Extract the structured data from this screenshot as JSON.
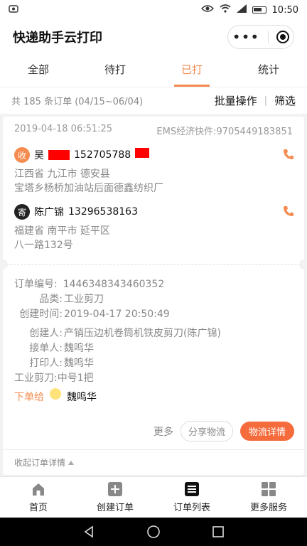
{
  "status_bar": {
    "time": "10:50"
  },
  "app": {
    "title": "快递助手云打印"
  },
  "tabs": [
    {
      "label": "全部",
      "active": false
    },
    {
      "label": "待打",
      "active": false
    },
    {
      "label": "已打",
      "active": true
    },
    {
      "label": "统计",
      "active": false
    }
  ],
  "summary": {
    "count_text": "共 185 条订单 (04/15~06/04)",
    "batch_label": "批量操作",
    "filter_label": "筛选"
  },
  "order": {
    "datetime": "2019-04-18 06:51:25",
    "carrier_tracking": "EMS经济快件:9705449183851",
    "recipient": {
      "badge": "收",
      "name_prefix": "吴",
      "phone_partial": "152705788",
      "address_line1": "江西省 九江市 德安县",
      "address_line2": "宝塔乡杨桥加油站后面德鑫纺织厂"
    },
    "sender": {
      "badge": "寄",
      "name": "陈广锦",
      "phone": "13296538163",
      "address_line1": "福建省 南平市 延平区",
      "address_line2": "八一路132号"
    },
    "details": {
      "order_no_label": "订单编号:",
      "order_no": "1446348343460352",
      "category_label": "品类:",
      "category": "工业剪刀",
      "created_label": "创建时间:",
      "created": "2019-04-17 20:50:49",
      "creator_label": "创建人:",
      "creator": "产销压边机卷筒机铁皮剪刀(陈广锦)",
      "receiver_label": "接单人:",
      "receiver": "魏鸣华",
      "printer_label": "打印人:",
      "printer": "魏鸣华",
      "item_line": "工业剪刀:中号1把"
    },
    "assign_label": "下单给",
    "assign_name": "魏鸣华",
    "more_label": "更多",
    "share_label": "分享物流",
    "logistics_label": "物流详情",
    "collapse_label": "收起订单详情"
  },
  "bottom_nav": [
    {
      "label": "首页",
      "icon": "home-icon"
    },
    {
      "label": "创建订单",
      "icon": "plus-icon"
    },
    {
      "label": "订单列表",
      "icon": "list-icon"
    },
    {
      "label": "更多服务",
      "icon": "grid-icon"
    }
  ],
  "colors": {
    "accent": "#f58b4e",
    "button": "#f56b3c",
    "redaction": "#ff0000"
  }
}
